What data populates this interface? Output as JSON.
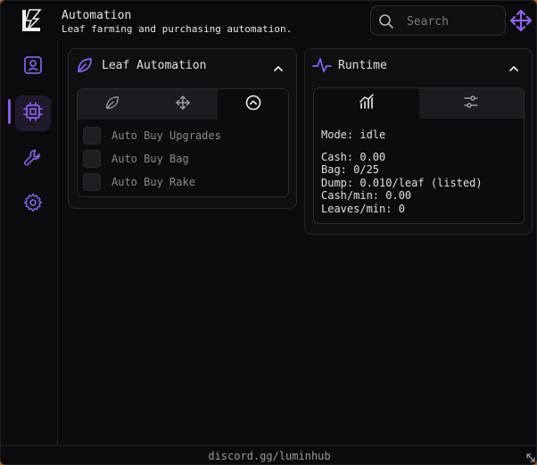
{
  "header": {
    "title": "Automation",
    "subtitle": "Leaf farming and purchasing automation."
  },
  "search": {
    "placeholder": "Search"
  },
  "sidebar": {
    "items": [
      {
        "icon": "profile-icon",
        "active": false
      },
      {
        "icon": "chip-icon",
        "active": true
      },
      {
        "icon": "wrench-icon",
        "active": false
      },
      {
        "icon": "gear-icon",
        "active": false
      }
    ]
  },
  "leaf_panel": {
    "title": "Leaf Automation",
    "tabs": [
      {
        "icon": "leaf-icon",
        "active": false
      },
      {
        "icon": "move-arrows-icon",
        "active": false
      },
      {
        "icon": "chevron-circle-up-icon",
        "active": true
      }
    ],
    "options": [
      {
        "label": "Auto Buy Upgrades",
        "checked": false
      },
      {
        "label": "Auto Buy Bag",
        "checked": false
      },
      {
        "label": "Auto Buy Rake",
        "checked": false
      }
    ]
  },
  "runtime_panel": {
    "title": "Runtime",
    "tabs": [
      {
        "icon": "chart-icon",
        "active": true
      },
      {
        "icon": "sliders-icon",
        "active": false
      }
    ],
    "mode": "Mode: idle",
    "cash": "Cash: 0.00",
    "bag": "Bag: 0/25",
    "dump": "Dump: 0.010/leaf (listed)",
    "cash_per_min": "Cash/min: 0.00",
    "leaves_per_min": "Leaves/min: 0"
  },
  "footer": {
    "text": "discord.gg/luminhub"
  },
  "colors": {
    "accent": "#7f5fd9",
    "background": "#0b0b0d",
    "panel": "#0f0f12"
  }
}
